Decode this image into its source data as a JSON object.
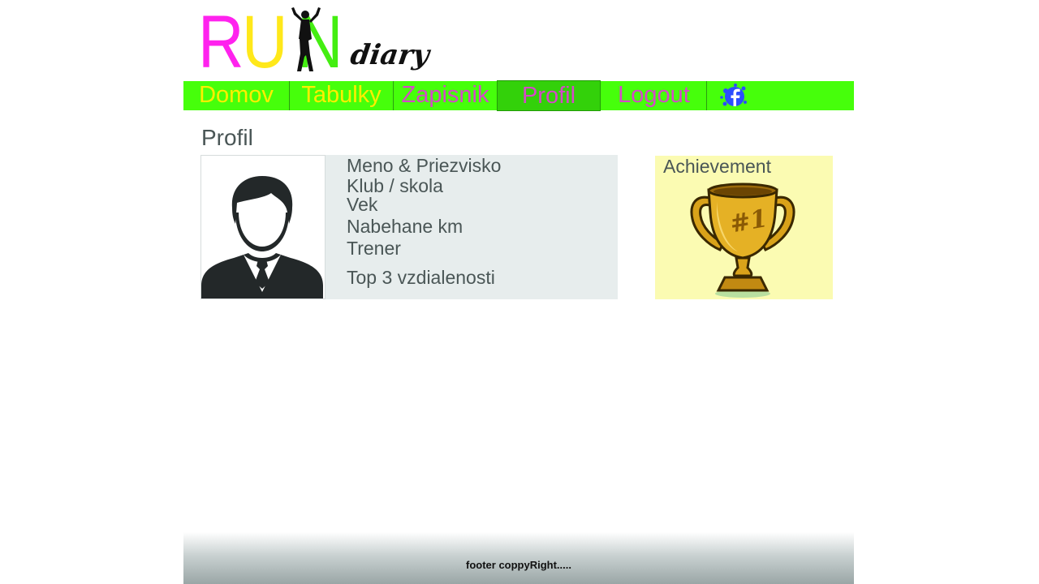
{
  "header": {
    "logo": {
      "letters": [
        "R",
        "U",
        "N"
      ],
      "tagline": "diary",
      "colors": {
        "r": "#ff22ee",
        "u": "#ffe81a",
        "n": "#44ee11"
      }
    }
  },
  "nav": {
    "background": "#46ff0b",
    "active": "Profil",
    "items": [
      {
        "label": "Domov"
      },
      {
        "label": "Tabulky"
      },
      {
        "label": "Zapisnik"
      },
      {
        "label": "Profil"
      },
      {
        "label": "Logout"
      }
    ],
    "social_icon": "facebook-splash-icon"
  },
  "main": {
    "title": "Profil",
    "avatar_icon": "user-avatar-icon",
    "fields": [
      "Meno & Priezvisko",
      "Klub / skola",
      "Vek",
      "Nabehane km",
      "Trener",
      "Top 3 vzdialenosti"
    ],
    "achievement": {
      "title": "Achievement",
      "icon": "trophy-icon",
      "trophy_text": "#1"
    }
  },
  "footer": {
    "text": "footer coppyRight....."
  }
}
